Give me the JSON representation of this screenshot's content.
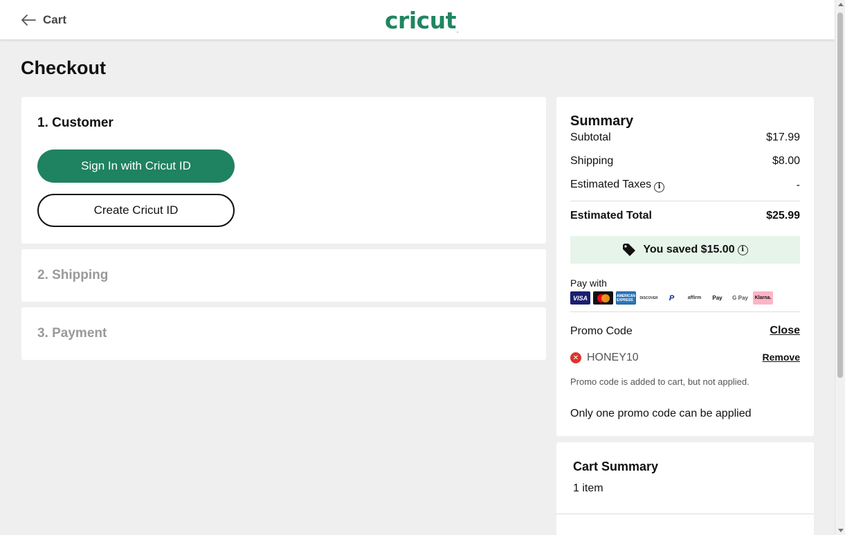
{
  "header": {
    "back_label": "Cart",
    "logo_text": "cricut",
    "logo_tm": ".",
    "brand_color": "#1e8660"
  },
  "page": {
    "title": "Checkout"
  },
  "steps": {
    "customer": {
      "title": "1. Customer",
      "signin_label": "Sign In with Cricut ID",
      "create_label": "Create Cricut ID"
    },
    "shipping": {
      "title": "2. Shipping"
    },
    "payment": {
      "title": "3. Payment"
    }
  },
  "summary": {
    "title": "Summary",
    "subtotal_label": "Subtotal",
    "subtotal_value": "$17.99",
    "shipping_label": "Shipping",
    "shipping_value": "$8.00",
    "taxes_label": "Estimated Taxes",
    "taxes_value": "-",
    "total_label": "Estimated Total",
    "total_value": "$25.99",
    "saved_text": "You saved $15.00",
    "pay_with_label": "Pay with",
    "pay_methods": {
      "visa": "VISA",
      "amex": "AMERICAN EXPRESS",
      "discover": "DISCOVER",
      "paypal": "P",
      "affirm": "affirm",
      "applepay": " Pay",
      "googlepay": "G Pay",
      "klarna": "Klarna."
    },
    "promo_label": "Promo Code",
    "close_label": "Close",
    "promo_code": "HONEY10",
    "remove_label": "Remove",
    "promo_note": "Promo code is added to cart, but not applied.",
    "promo_only": "Only one promo code can be applied",
    "info_glyph": "i",
    "error_glyph": "✕"
  },
  "cart_summary": {
    "title": "Cart Summary",
    "count": "1 item"
  }
}
